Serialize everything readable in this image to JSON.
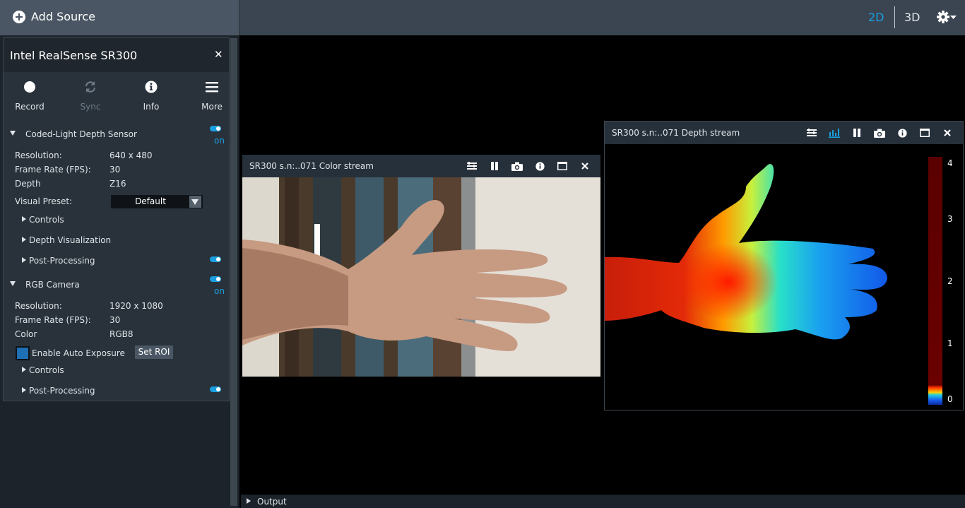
{
  "topbar": {
    "add_source_label": "Add Source",
    "view_2d": "2D",
    "view_3d": "3D"
  },
  "colors": {
    "accent": "#199fe0",
    "panel": "#29323b",
    "titlebar": "#1f262d"
  },
  "device": {
    "name": "Intel RealSense SR300",
    "toolbar": [
      {
        "label": "Record",
        "icon": "record-icon",
        "enabled": true
      },
      {
        "label": "Sync",
        "icon": "sync-icon",
        "enabled": false
      },
      {
        "label": "Info",
        "icon": "info-icon",
        "enabled": true
      },
      {
        "label": "More",
        "icon": "menu-icon",
        "enabled": true
      }
    ],
    "depth_sensor": {
      "title": "Coded-Light Depth Sensor",
      "toggle_label": "on",
      "rows": [
        {
          "label": "Resolution:",
          "value": "640 x 480"
        },
        {
          "label": "Frame Rate (FPS):",
          "value": "30"
        },
        {
          "label": "Depth",
          "value": "Z16"
        }
      ],
      "preset_label": "Visual Preset:",
      "preset_value": "Default",
      "subsections": [
        "Controls",
        "Depth Visualization",
        "Post-Processing"
      ]
    },
    "rgb_camera": {
      "title": "RGB Camera",
      "toggle_label": "on",
      "rows": [
        {
          "label": "Resolution:",
          "value": "1920 x 1080"
        },
        {
          "label": "Frame Rate (FPS):",
          "value": "30"
        },
        {
          "label": "Color",
          "value": "RGB8"
        }
      ],
      "auto_exposure_label": "Enable Auto Exposure",
      "set_roi_label": "Set ROI",
      "subsections": [
        "Controls",
        "Post-Processing"
      ]
    }
  },
  "streams": {
    "color": {
      "title": "SR300 s.n:..071 Color stream"
    },
    "depth": {
      "title": "SR300 s.n:..071 Depth stream",
      "legend": [
        "4",
        "3",
        "2",
        "1",
        "0"
      ]
    }
  },
  "output": {
    "label": "Output"
  }
}
